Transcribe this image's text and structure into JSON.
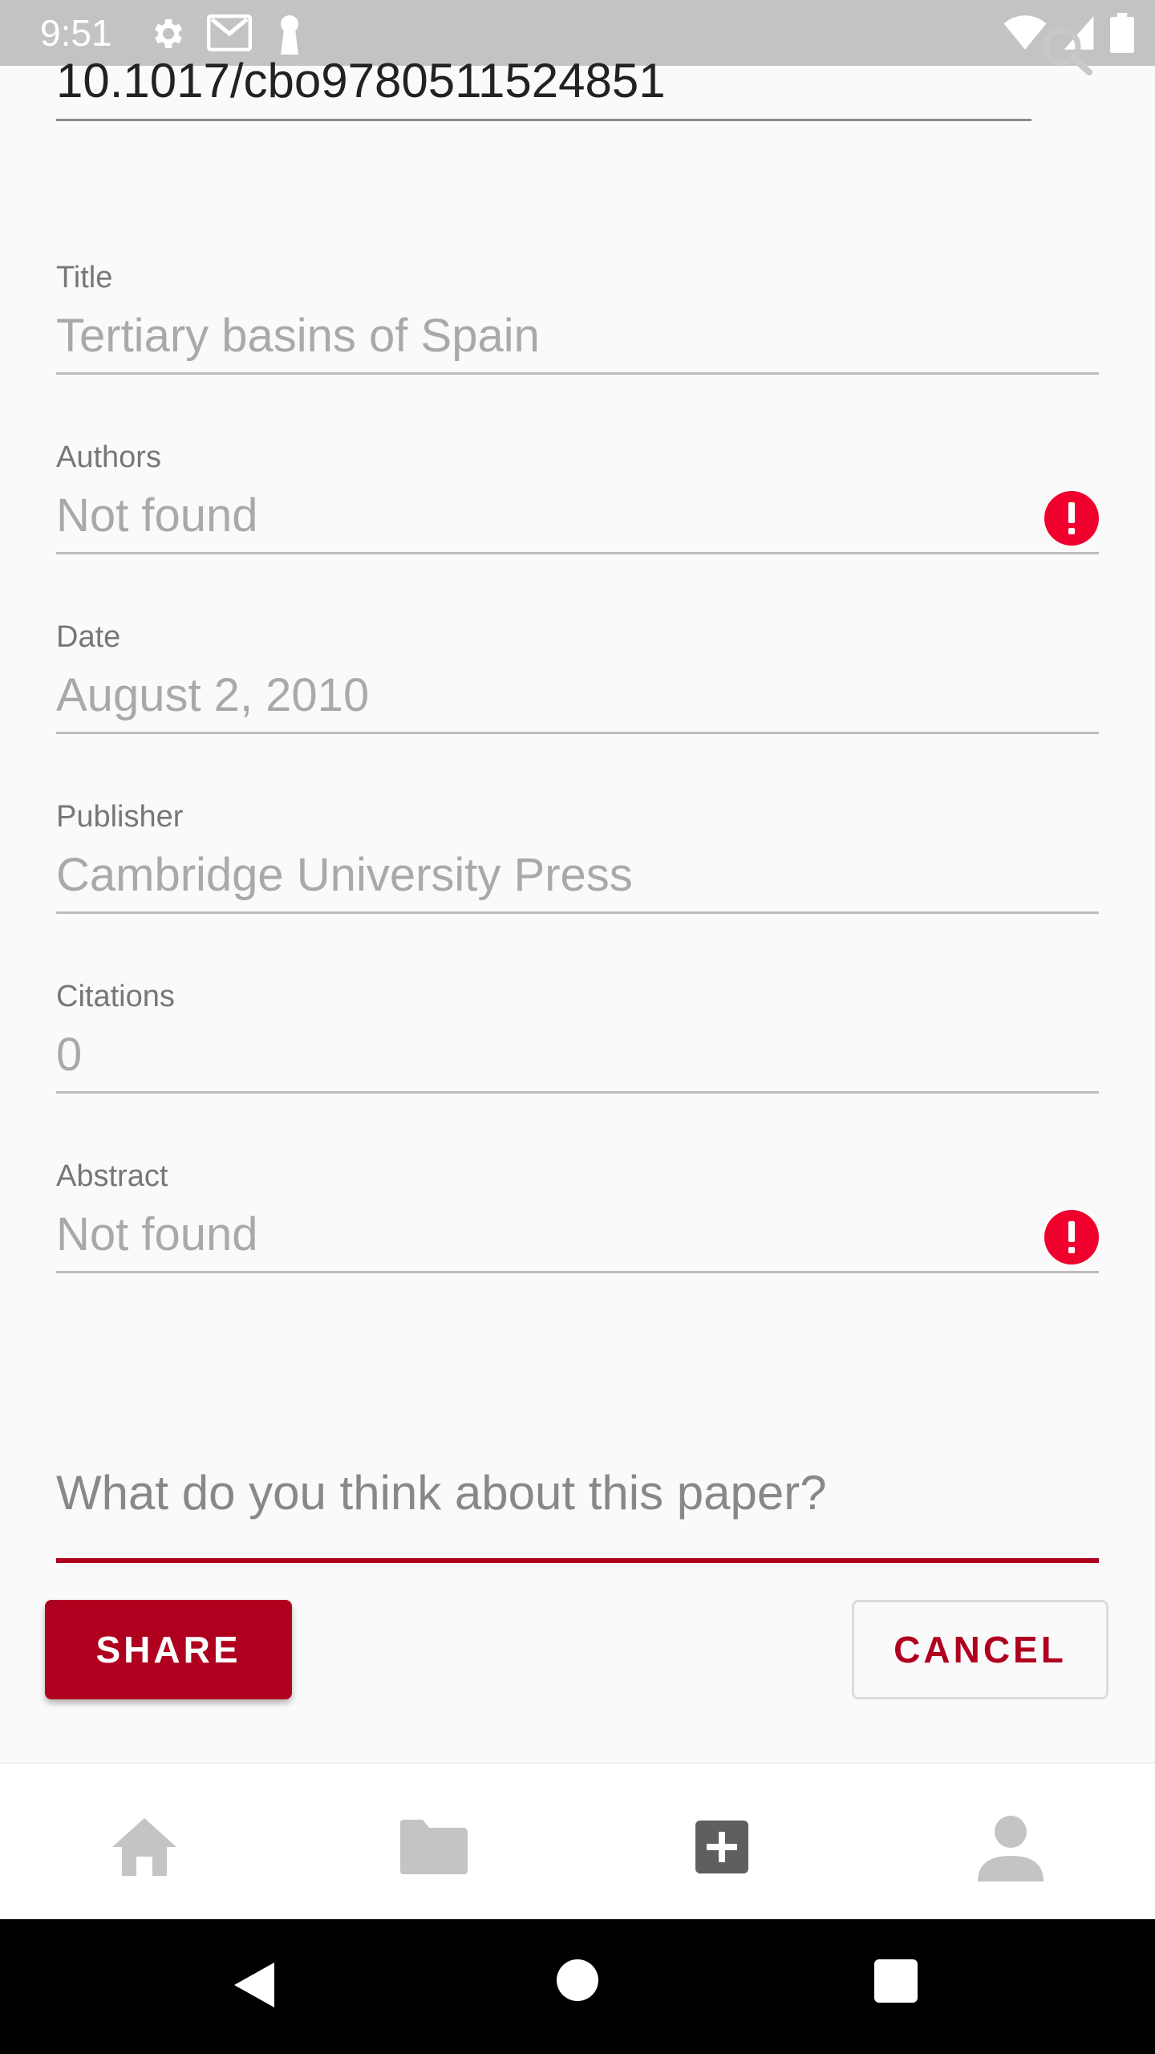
{
  "status_bar": {
    "time": "9:51",
    "left_icons": [
      "gear-icon",
      "gmail-icon",
      "keyhole-icon"
    ],
    "right_icons": [
      "wifi-icon",
      "signal-icon",
      "battery-icon"
    ]
  },
  "doi_search": {
    "value": "10.1017/cbo9780511524851",
    "icon": "search-icon"
  },
  "fields": {
    "title": {
      "label": "Title",
      "value": "Tertiary basins of Spain"
    },
    "authors": {
      "label": "Authors",
      "value": "Not found",
      "error": true
    },
    "date": {
      "label": "Date",
      "value": "August 2, 2010"
    },
    "publisher": {
      "label": "Publisher",
      "value": "Cambridge University Press"
    },
    "citations": {
      "label": "Citations",
      "value": "0"
    },
    "abstract": {
      "label": "Abstract",
      "value": "Not found",
      "error": true
    }
  },
  "comment": {
    "placeholder": "What do you think about this paper?"
  },
  "actions": {
    "share_label": "SHARE",
    "cancel_label": "CANCEL"
  },
  "bottom_nav": {
    "items": [
      "home-icon",
      "folder-icon",
      "add-icon",
      "profile-icon"
    ],
    "active": "add-icon"
  },
  "colors": {
    "accent": "#b00020",
    "error": "#f0002d",
    "status_bar": "#c3c3c3"
  }
}
